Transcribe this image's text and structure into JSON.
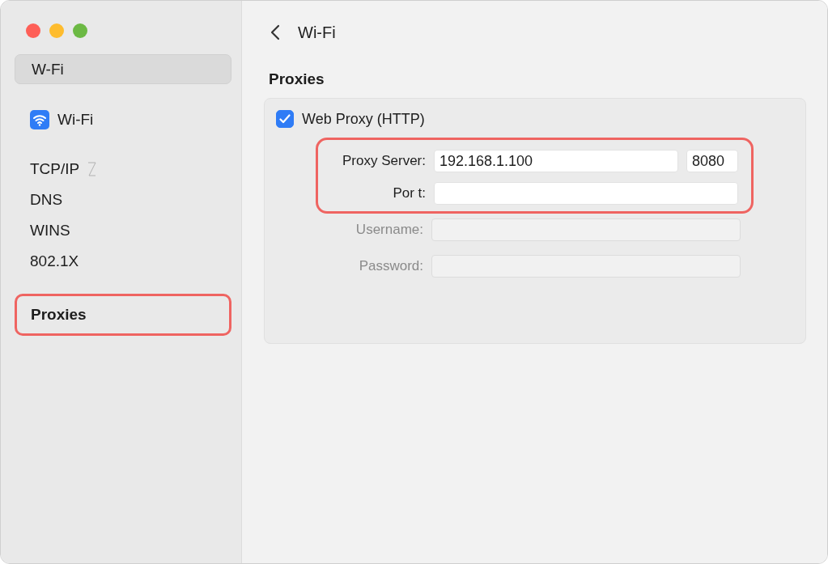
{
  "sidebar": {
    "items": [
      {
        "kind": "header",
        "label": "W-Fi",
        "selected": true,
        "highlighted": false,
        "loading": false
      },
      {
        "kind": "network",
        "label": "Wi-Fi",
        "selected": false,
        "highlighted": false,
        "loading": false
      },
      {
        "kind": "section",
        "label": "TCP/IP",
        "selected": false,
        "highlighted": false,
        "loading": true
      },
      {
        "kind": "section",
        "label": "DNS",
        "selected": false,
        "highlighted": false,
        "loading": false
      },
      {
        "kind": "section",
        "label": "WINS",
        "selected": false,
        "highlighted": false,
        "loading": false
      },
      {
        "kind": "section",
        "label": "802.1X",
        "selected": false,
        "highlighted": false,
        "loading": false
      },
      {
        "kind": "section",
        "label": "Proxies",
        "selected": false,
        "highlighted": true,
        "loading": false
      }
    ]
  },
  "header": {
    "title": "Wi-Fi"
  },
  "section_title": "Proxies",
  "proxy": {
    "label": "Web Proxy (HTTP)",
    "checked": true,
    "fields": [
      {
        "label": "Proxy Server:",
        "value": "192.168.1.100",
        "port": "8080",
        "disabled": false,
        "highlighted": true
      },
      {
        "label": "Por t:",
        "disabled": false,
        "highlighted": true
      },
      {
        "label": "Username:",
        "disabled": true,
        "highlighted": false
      },
      {
        "label": "Password:",
        "disabled": true,
        "highlighted": false
      }
    ]
  }
}
